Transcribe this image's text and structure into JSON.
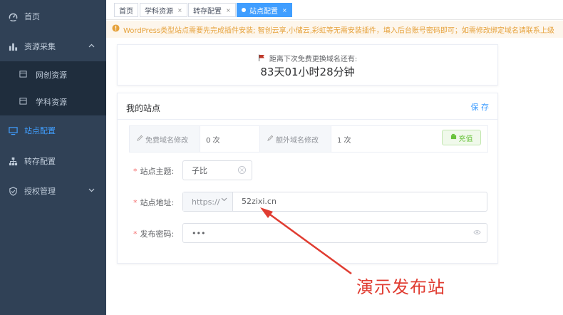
{
  "sidebar": {
    "items": [
      {
        "label": "首页",
        "icon": "dashboard-icon"
      },
      {
        "label": "资源采集",
        "icon": "bar-chart-icon",
        "arrow": "^"
      },
      {
        "label": "网创资源",
        "icon": "calendar-icon"
      },
      {
        "label": "学科资源",
        "icon": "calendar-icon"
      },
      {
        "label": "站点配置",
        "icon": "monitor-icon"
      },
      {
        "label": "转存配置",
        "icon": "sitemap-icon"
      },
      {
        "label": "授权管理",
        "icon": "shield-icon",
        "arrow": "v"
      }
    ]
  },
  "tabs": [
    {
      "label": "首页"
    },
    {
      "label": "学科资源",
      "close": "×"
    },
    {
      "label": "转存配置",
      "close": "×"
    },
    {
      "label": "站点配置",
      "close": "×"
    }
  ],
  "alert": {
    "text": "WordPress类型站点需要先完成插件安装; 智创云享,小储云,彩虹等无需安装插件，填入后台账号密码即可；如需修改绑定域名请联系上级"
  },
  "countdown": {
    "caption": "距离下次免费更换域名还有:",
    "time": "83天01小时28分钟"
  },
  "site": {
    "title": "我的站点",
    "save_label": "保 存",
    "free_domain_label": "免费域名修改",
    "free_domain_value": "0 次",
    "extra_domain_label": "额外域名修改",
    "extra_domain_value": "1 次",
    "recharge_label": "充值",
    "theme_label": "站点主题:",
    "theme_value": "子比",
    "address_label": "站点地址:",
    "protocol_value": "https://",
    "address_value": "52zixi.cn",
    "password_label": "发布密码:",
    "password_value": "•••",
    "required_mark": "*"
  },
  "annotation": {
    "text": "演示发布站",
    "color": "#e03c31"
  },
  "colors": {
    "sidebar_bg": "#304156",
    "accent": "#409eff",
    "warning": "#e6a23c",
    "success": "#67c23a"
  }
}
